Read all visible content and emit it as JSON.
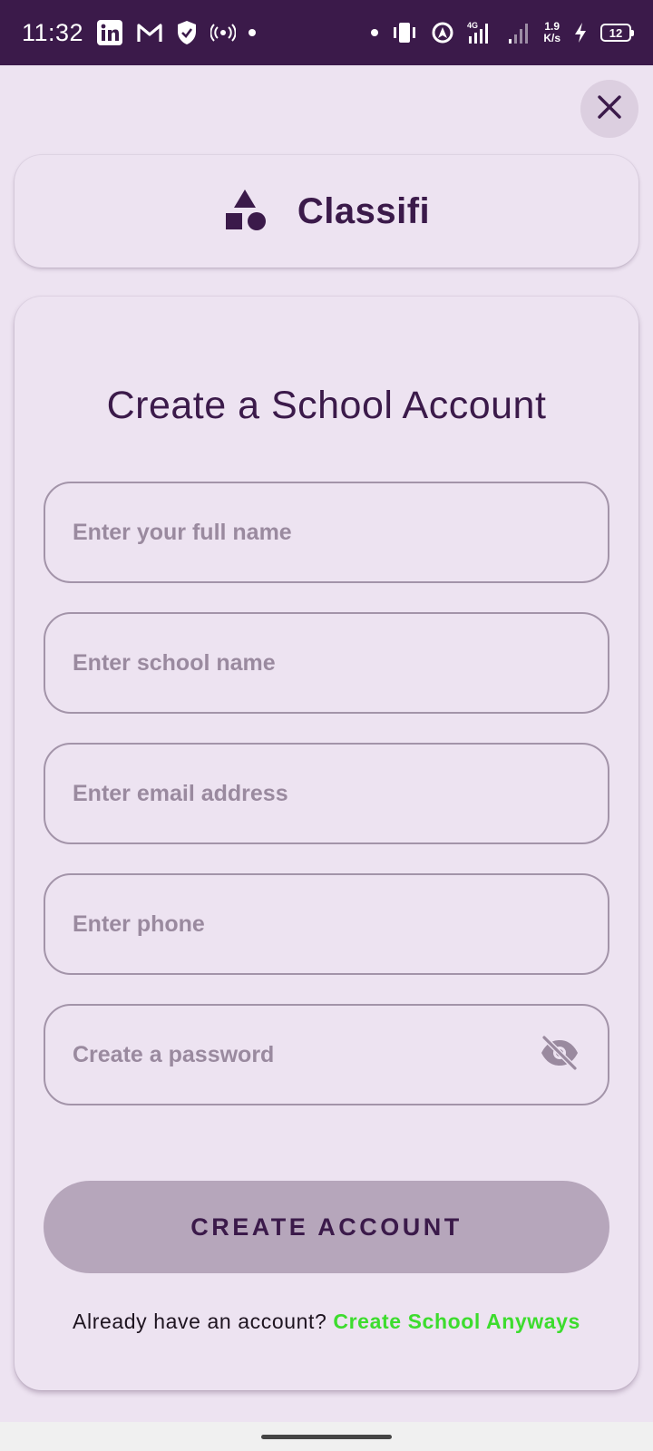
{
  "status_bar": {
    "time": "11:32",
    "network_speed_value": "1.9",
    "network_speed_unit": "K/s",
    "network_type": "4G",
    "battery": "12",
    "left_icons": [
      "linkedin-icon",
      "gmail-icon",
      "shield-icon",
      "hotspot-icon"
    ],
    "right_icons": [
      "vibrate-icon",
      "location-icon",
      "signal-4g-icon",
      "signal-icon",
      "charging-icon",
      "battery-icon"
    ]
  },
  "header": {
    "close_icon": "close-icon"
  },
  "brand": {
    "logo_icon": "shapes-icon",
    "name": "Classifi"
  },
  "form": {
    "title": "Create a School Account",
    "fields": [
      {
        "name": "full-name",
        "placeholder": "Enter your full name",
        "value": ""
      },
      {
        "name": "school-name",
        "placeholder": "Enter school name",
        "value": ""
      },
      {
        "name": "email",
        "placeholder": "Enter email address",
        "value": ""
      },
      {
        "name": "phone",
        "placeholder": "Enter phone",
        "value": ""
      },
      {
        "name": "password",
        "placeholder": "Create a password",
        "value": "",
        "toggle_icon": "eye-off-icon"
      }
    ],
    "submit_label": "CREATE ACCOUNT",
    "footer_text": "Already have an account?",
    "footer_link": "Create School Anyways"
  },
  "colors": {
    "status_bar_bg": "#3b1a4a",
    "background": "#ede3f1",
    "primary_text": "#3b1a4a",
    "field_border": "#a394a9",
    "placeholder": "#9a8a9f",
    "button_bg": "#b6a6bb",
    "link": "#3ddc2e"
  }
}
